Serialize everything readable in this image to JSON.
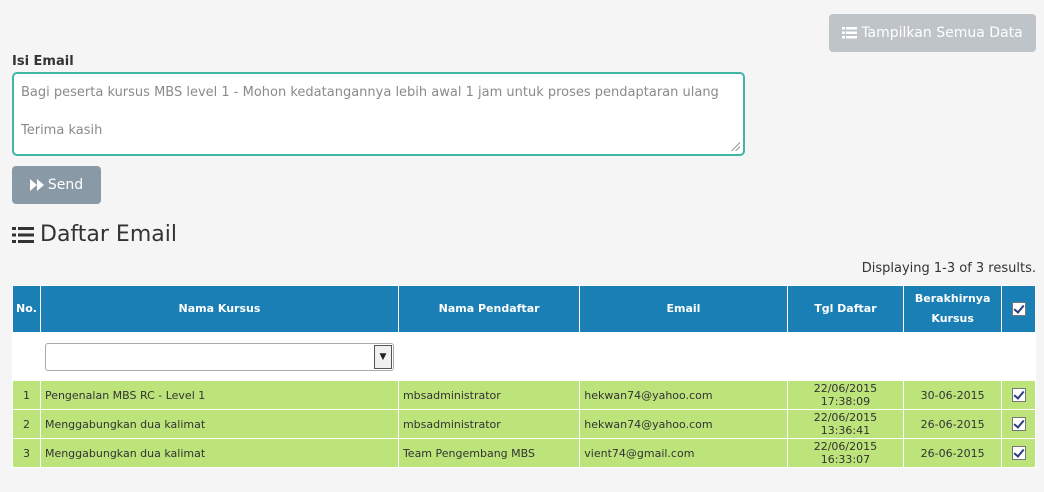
{
  "toolbar": {
    "show_all_label": "Tampilkan Semua Data"
  },
  "compose": {
    "label": "Isi Email",
    "line1": "Bagi peserta kursus MBS level 1 - Mohon kedatangannya lebih awal 1 jam untuk proses pendaptaran ulang",
    "line2": "Terima kasih",
    "send_label": "Send"
  },
  "list": {
    "title": "Daftar Email",
    "summary": "Displaying 1-3 of 3 results.",
    "columns": {
      "no": "No.",
      "course": "Nama Kursus",
      "registrant": "Nama Pendaftar",
      "email": "Email",
      "date": "Tgl Daftar",
      "end_line1": "Berakhirnya",
      "end_line2": "Kursus"
    },
    "header_checked": true,
    "rows": [
      {
        "no": "1",
        "course": "Pengenalan MBS RC - Level 1",
        "registrant": "mbsadministrator",
        "email": "hekwan74@yahoo.com",
        "date": "22/06/2015 17:38:09",
        "end": "30-06-2015",
        "checked": true
      },
      {
        "no": "2",
        "course": "Menggabungkan dua kalimat",
        "registrant": "mbsadministrator",
        "email": "hekwan74@yahoo.com",
        "date": "22/06/2015 13:36:41",
        "end": "26-06-2015",
        "checked": true
      },
      {
        "no": "3",
        "course": "Menggabungkan dua kalimat",
        "registrant": "Team Pengembang MBS",
        "email": "vient74@gmail.com",
        "date": "22/06/2015 16:33:07",
        "end": "26-06-2015",
        "checked": true
      }
    ]
  },
  "colors": {
    "header_bg": "#1a7fb4",
    "row_bg": "#bde47a",
    "textarea_border": "#3fb6a6",
    "send_bg": "#8a99a6",
    "show_all_bg": "#bfc4c8"
  },
  "icons": {
    "show_all": "list-icon",
    "send": "fast-forward-icon",
    "title": "list-icon",
    "filter_dropdown": "triangle-down-icon",
    "checkbox": "checkbox-checked-icon"
  }
}
